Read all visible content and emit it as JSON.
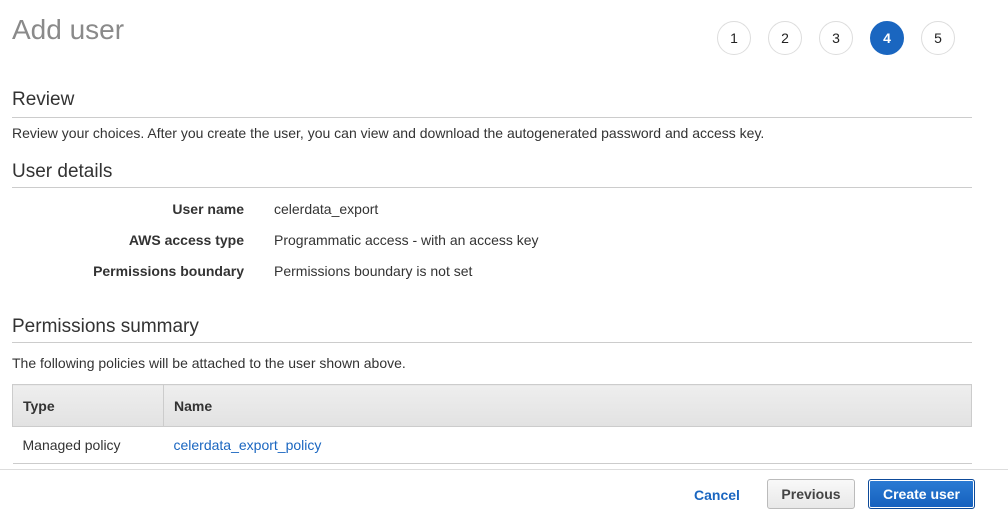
{
  "page": {
    "title": "Add user"
  },
  "steps": {
    "items": [
      "1",
      "2",
      "3",
      "4",
      "5"
    ],
    "current": "4"
  },
  "review": {
    "title": "Review",
    "description": "Review your choices. After you create the user, you can view and download the autogenerated password and access key."
  },
  "user_details": {
    "title": "User details",
    "rows": [
      {
        "label": "User name",
        "value": "celerdata_export"
      },
      {
        "label": "AWS access type",
        "value": "Programmatic access - with an access key"
      },
      {
        "label": "Permissions boundary",
        "value": "Permissions boundary is not set"
      }
    ]
  },
  "permissions_summary": {
    "title": "Permissions summary",
    "description": "The following policies will be attached to the user shown above.",
    "columns": [
      "Type",
      "Name"
    ],
    "rows": [
      {
        "type": "Managed policy",
        "name": "celerdata_export_policy"
      }
    ]
  },
  "footer": {
    "cancel_label": "Cancel",
    "previous_label": "Previous",
    "create_label": "Create user"
  },
  "colors": {
    "accent": "#1a66c0"
  }
}
